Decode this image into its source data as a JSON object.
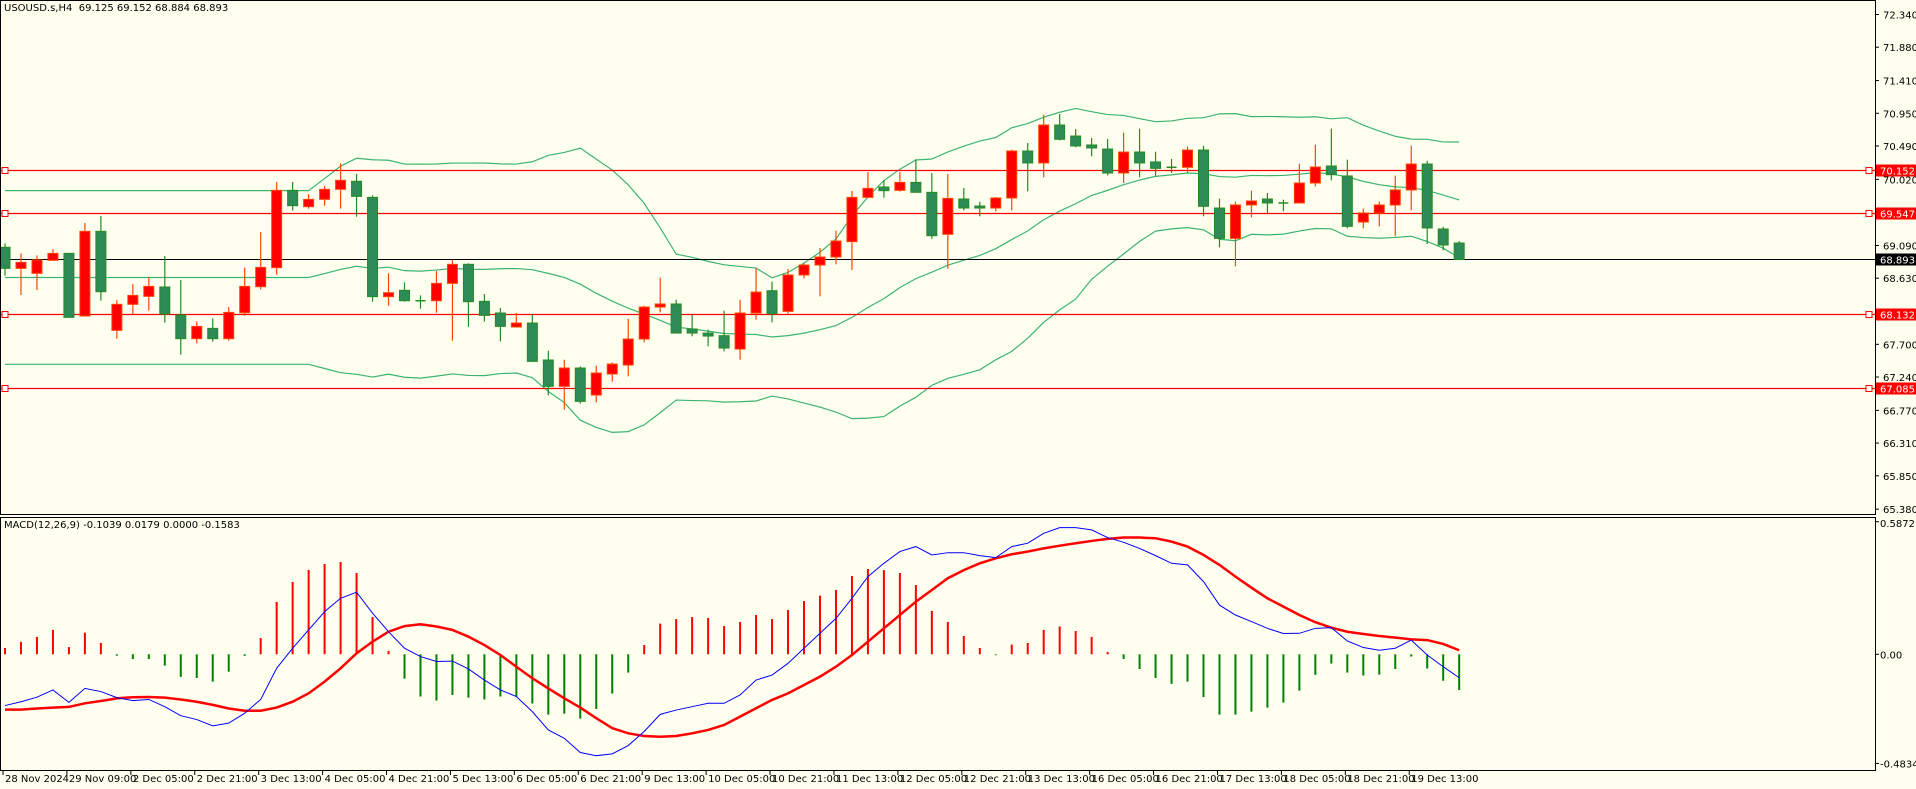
{
  "header": {
    "symbol": "USOUSD.s,H4",
    "ohlc": "69.125 69.152 68.884 68.893"
  },
  "macd_header": "MACD(12,26,9) -0.1039 0.0179 0.0000 -0.1583",
  "price_axis": {
    "ticks": [
      "72.340",
      "71.880",
      "71.410",
      "70.950",
      "70.490",
      "70.020",
      "69.090",
      "68.630",
      "67.700",
      "67.240",
      "66.770",
      "66.310",
      "65.850",
      "65.380"
    ]
  },
  "macd_axis": {
    "ticks": [
      "0.5872",
      "0.00",
      "-0.4834"
    ]
  },
  "time_axis": [
    "28 Nov 2024",
    "29 Nov 09:00",
    "2 Dec 05:00",
    "2 Dec 21:00",
    "3 Dec 13:00",
    "4 Dec 05:00",
    "4 Dec 21:00",
    "5 Dec 13:00",
    "6 Dec 05:00",
    "6 Dec 21:00",
    "9 Dec 13:00",
    "10 Dec 05:00",
    "10 Dec 21:00",
    "11 Dec 13:00",
    "12 Dec 05:00",
    "12 Dec 21:00",
    "13 Dec 13:00",
    "16 Dec 05:00",
    "16 Dec 21:00",
    "17 Dec 13:00",
    "18 Dec 05:00",
    "18 Dec 21:00",
    "19 Dec 13:00"
  ],
  "levels": [
    {
      "label": "70.152",
      "value": 70.152
    },
    {
      "label": "69.547",
      "value": 69.547
    },
    {
      "label": "68.132",
      "value": 68.132
    },
    {
      "label": "67.085",
      "value": 67.085
    }
  ],
  "current_price": {
    "label": "68.893",
    "value": 68.893
  },
  "colors": {
    "background": "#fffff0",
    "bull": "#ff0000",
    "bull_border": "#ff4500",
    "bear": "#2e8b57",
    "bear_border": "#228b22",
    "bands": "#3cb371",
    "level": "#ff0000",
    "macd": "#0000ff",
    "signal": "#ff0000"
  },
  "chart_data": {
    "type": "candlestick",
    "title": "USOUSD.s,H4",
    "ylim": [
      65.38,
      72.34
    ],
    "ohlc": [
      [
        69.064,
        69.12,
        68.665,
        68.768
      ],
      [
        68.768,
        68.979,
        68.393,
        68.853
      ],
      [
        68.698,
        68.951,
        68.463,
        68.886
      ],
      [
        68.881,
        69.04,
        68.881,
        68.979
      ],
      [
        68.979,
        68.979,
        68.079,
        68.079
      ],
      [
        68.098,
        69.406,
        68.098,
        69.289
      ],
      [
        69.289,
        69.505,
        68.313,
        68.44
      ],
      [
        67.896,
        68.323,
        67.779,
        68.262
      ],
      [
        68.262,
        68.548,
        68.126,
        68.388
      ],
      [
        68.374,
        68.646,
        68.173,
        68.515
      ],
      [
        68.506,
        68.942,
        68.004,
        68.126
      ],
      [
        68.112,
        68.604,
        67.554,
        67.779
      ],
      [
        67.779,
        68.023,
        67.713,
        67.952
      ],
      [
        67.924,
        68.065,
        67.736,
        67.779
      ],
      [
        67.779,
        68.224,
        67.75,
        68.149
      ],
      [
        68.144,
        68.778,
        68.102,
        68.515
      ],
      [
        68.51,
        69.28,
        68.473,
        68.782
      ],
      [
        68.778,
        69.983,
        68.679,
        69.866
      ],
      [
        69.866,
        69.983,
        69.58,
        69.65
      ],
      [
        69.636,
        69.81,
        69.608,
        69.739
      ],
      [
        69.739,
        69.927,
        69.65,
        69.88
      ],
      [
        69.88,
        70.246,
        69.608,
        70.007
      ],
      [
        69.993,
        70.096,
        69.495,
        69.781
      ],
      [
        69.767,
        69.796,
        68.299,
        68.37
      ],
      [
        68.37,
        68.698,
        68.243,
        68.426
      ],
      [
        68.459,
        68.571,
        68.299,
        68.313
      ],
      [
        68.313,
        68.388,
        68.201,
        68.313
      ],
      [
        68.313,
        68.731,
        68.144,
        68.557
      ],
      [
        68.557,
        68.886,
        67.75,
        68.825
      ],
      [
        68.825,
        68.839,
        67.947,
        68.299
      ],
      [
        68.304,
        68.407,
        68.018,
        68.107
      ],
      [
        68.14,
        68.21,
        67.741,
        67.952
      ],
      [
        67.943,
        68.14,
        67.943,
        67.999
      ],
      [
        67.999,
        68.116,
        67.46,
        67.46
      ],
      [
        67.479,
        67.61,
        66.981,
        67.108
      ],
      [
        67.108,
        67.483,
        66.78,
        67.366
      ],
      [
        67.366,
        67.39,
        66.864,
        66.897
      ],
      [
        66.986,
        67.399,
        66.883,
        67.296
      ],
      [
        67.282,
        67.445,
        67.174,
        67.422
      ],
      [
        67.408,
        68.06,
        67.249,
        67.774
      ],
      [
        67.774,
        68.243,
        67.727,
        68.224
      ],
      [
        68.224,
        68.637,
        68.149,
        68.267
      ],
      [
        68.267,
        68.327,
        67.858,
        67.858
      ],
      [
        67.915,
        68.116,
        67.812,
        67.858
      ],
      [
        67.858,
        67.905,
        67.671,
        67.816
      ],
      [
        67.821,
        68.173,
        67.6,
        67.647
      ],
      [
        67.633,
        68.327,
        67.483,
        68.14
      ],
      [
        68.14,
        68.768,
        68.046,
        68.435
      ],
      [
        68.454,
        68.581,
        68.009,
        68.13
      ],
      [
        68.163,
        68.759,
        68.13,
        68.675
      ],
      [
        68.675,
        68.834,
        68.628,
        68.815
      ],
      [
        68.815,
        69.055,
        68.374,
        68.928
      ],
      [
        68.928,
        69.298,
        68.825,
        69.153
      ],
      [
        69.144,
        69.857,
        68.745,
        69.767
      ],
      [
        69.767,
        70.124,
        69.753,
        69.894
      ],
      [
        69.913,
        70.011,
        69.763,
        69.861
      ],
      [
        69.866,
        70.124,
        69.847,
        69.978
      ],
      [
        69.978,
        70.302,
        69.838,
        69.838
      ],
      [
        69.838,
        70.11,
        69.186,
        69.228
      ],
      [
        69.247,
        70.096,
        68.764,
        69.753
      ],
      [
        69.744,
        69.899,
        69.584,
        69.617
      ],
      [
        69.645,
        69.706,
        69.5,
        69.617
      ],
      [
        69.617,
        69.772,
        69.57,
        69.758
      ],
      [
        69.758,
        70.438,
        69.584,
        70.419
      ],
      [
        70.419,
        70.532,
        69.852,
        70.251
      ],
      [
        70.251,
        70.931,
        70.049,
        70.785
      ],
      [
        70.785,
        70.94,
        70.569,
        70.584
      ],
      [
        70.63,
        70.729,
        70.471,
        70.49
      ],
      [
        70.504,
        70.602,
        70.344,
        70.462
      ],
      [
        70.447,
        70.588,
        70.077,
        70.11
      ],
      [
        70.11,
        70.677,
        69.969,
        70.405
      ],
      [
        70.405,
        70.734,
        70.049,
        70.251
      ],
      [
        70.265,
        70.41,
        70.072,
        70.175
      ],
      [
        70.19,
        70.307,
        70.11,
        70.19
      ],
      [
        70.19,
        70.48,
        70.119,
        70.433
      ],
      [
        70.433,
        70.494,
        69.5,
        69.641
      ],
      [
        69.617,
        69.749,
        69.064,
        69.19
      ],
      [
        69.19,
        69.706,
        68.796,
        69.66
      ],
      [
        69.66,
        69.861,
        69.486,
        69.716
      ],
      [
        69.744,
        69.828,
        69.547,
        69.688
      ],
      [
        69.688,
        69.735,
        69.57,
        69.688
      ],
      [
        69.688,
        70.241,
        69.688,
        69.969
      ],
      [
        69.969,
        70.508,
        69.922,
        70.194
      ],
      [
        70.208,
        70.734,
        70.007,
        70.086
      ],
      [
        70.068,
        70.297,
        69.331,
        69.359
      ],
      [
        69.42,
        69.608,
        69.331,
        69.547
      ],
      [
        69.547,
        69.706,
        69.359,
        69.66
      ],
      [
        69.66,
        70.072,
        69.219,
        69.871
      ],
      [
        69.871,
        70.494,
        69.584,
        70.236
      ],
      [
        70.236,
        70.283,
        69.111,
        69.336
      ],
      [
        69.322,
        69.355,
        69.022,
        69.097
      ],
      [
        69.125,
        69.152,
        68.884,
        68.893
      ]
    ],
    "bollinger": {
      "period": 20,
      "deviations": 2
    },
    "macd": {
      "params": "12,26,9",
      "ylim": [
        -0.4834,
        0.5872
      ],
      "histogram": [
        0.028,
        0.055,
        0.077,
        0.108,
        0.032,
        0.096,
        0.05,
        -0.002,
        -0.021,
        -0.021,
        -0.05,
        -0.1,
        -0.105,
        -0.121,
        -0.077,
        -0.007,
        0.072,
        0.232,
        0.32,
        0.374,
        0.4,
        0.409,
        0.36,
        0.165,
        0.015,
        -0.108,
        -0.187,
        -0.205,
        -0.18,
        -0.192,
        -0.2,
        -0.187,
        -0.187,
        -0.218,
        -0.267,
        -0.263,
        -0.285,
        -0.242,
        -0.174,
        -0.081,
        0.041,
        0.136,
        0.156,
        0.165,
        0.161,
        0.125,
        0.143,
        0.174,
        0.156,
        0.196,
        0.236,
        0.26,
        0.285,
        0.347,
        0.378,
        0.373,
        0.36,
        0.307,
        0.192,
        0.143,
        0.081,
        0.028,
        -0.004,
        0.043,
        0.05,
        0.108,
        0.123,
        0.103,
        0.077,
        0.01,
        -0.021,
        -0.065,
        -0.105,
        -0.131,
        -0.121,
        -0.189,
        -0.267,
        -0.267,
        -0.254,
        -0.236,
        -0.214,
        -0.161,
        -0.091,
        -0.041,
        -0.081,
        -0.094,
        -0.09,
        -0.065,
        -0.01,
        -0.063,
        -0.117,
        -0.1583
      ],
      "macd_line": [
        -0.227,
        -0.21,
        -0.19,
        -0.158,
        -0.213,
        -0.151,
        -0.165,
        -0.192,
        -0.205,
        -0.2,
        -0.232,
        -0.272,
        -0.289,
        -0.317,
        -0.305,
        -0.261,
        -0.2,
        -0.062,
        0.027,
        0.108,
        0.189,
        0.248,
        0.275,
        0.182,
        0.1,
        0.027,
        -0.01,
        -0.032,
        -0.03,
        -0.065,
        -0.114,
        -0.158,
        -0.187,
        -0.254,
        -0.335,
        -0.372,
        -0.435,
        -0.449,
        -0.441,
        -0.404,
        -0.342,
        -0.266,
        -0.247,
        -0.232,
        -0.217,
        -0.217,
        -0.18,
        -0.114,
        -0.092,
        -0.04,
        0.027,
        0.093,
        0.159,
        0.248,
        0.344,
        0.403,
        0.455,
        0.477,
        0.44,
        0.45,
        0.45,
        0.437,
        0.428,
        0.477,
        0.492,
        0.536,
        0.561,
        0.561,
        0.551,
        0.517,
        0.496,
        0.469,
        0.437,
        0.403,
        0.396,
        0.322,
        0.218,
        0.174,
        0.145,
        0.115,
        0.092,
        0.093,
        0.115,
        0.118,
        0.059,
        0.03,
        0.018,
        0.027,
        0.063,
        -0.003,
        -0.055,
        -0.1039
      ],
      "signal_line": [
        -0.245,
        -0.245,
        -0.24,
        -0.236,
        -0.233,
        -0.217,
        -0.207,
        -0.195,
        -0.19,
        -0.189,
        -0.192,
        -0.2,
        -0.21,
        -0.224,
        -0.24,
        -0.25,
        -0.25,
        -0.236,
        -0.21,
        -0.173,
        -0.121,
        -0.062,
        0.004,
        0.056,
        0.1,
        0.125,
        0.133,
        0.123,
        0.108,
        0.078,
        0.041,
        -0.003,
        -0.055,
        -0.106,
        -0.151,
        -0.195,
        -0.236,
        -0.283,
        -0.327,
        -0.35,
        -0.362,
        -0.365,
        -0.362,
        -0.35,
        -0.335,
        -0.313,
        -0.276,
        -0.239,
        -0.202,
        -0.173,
        -0.136,
        -0.099,
        -0.055,
        -0.003,
        0.056,
        0.115,
        0.174,
        0.233,
        0.285,
        0.337,
        0.373,
        0.403,
        0.425,
        0.443,
        0.455,
        0.469,
        0.481,
        0.492,
        0.502,
        0.511,
        0.517,
        0.517,
        0.514,
        0.499,
        0.477,
        0.44,
        0.396,
        0.344,
        0.295,
        0.248,
        0.211,
        0.174,
        0.142,
        0.118,
        0.1,
        0.09,
        0.081,
        0.074,
        0.066,
        0.063,
        0.046,
        0.0179
      ]
    }
  }
}
